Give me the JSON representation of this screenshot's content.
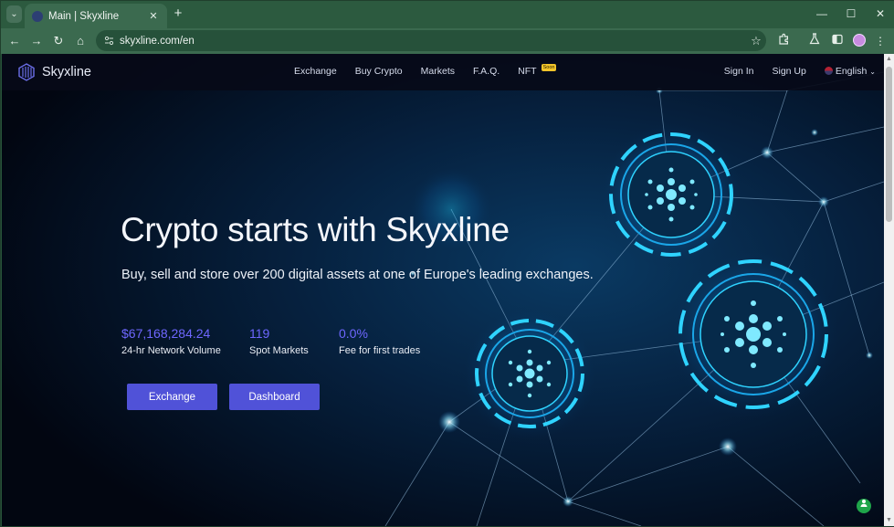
{
  "browser": {
    "tab": {
      "title": "Main | Skyxline",
      "close_glyph": "✕"
    },
    "new_tab_glyph": "+",
    "tab_search_glyph": "⌄",
    "window_controls": {
      "minimize": "—",
      "maximize": "☐",
      "close": "✕"
    },
    "nav": {
      "back": "←",
      "forward": "→",
      "reload": "↻",
      "home": "⌂"
    },
    "url": "skyxline.com/en",
    "icons": [
      "site-info-icon",
      "bookmark-star-icon",
      "extensions-icon",
      "labs-flask-icon",
      "side-panel-icon",
      "profile-avatar",
      "browser-menu-icon"
    ]
  },
  "site": {
    "brand": "Skyxline",
    "nav": {
      "exchange": "Exchange",
      "buy_crypto": "Buy Crypto",
      "markets": "Markets",
      "faq": "F.A.Q.",
      "nft": "NFT",
      "nft_badge": "Soon"
    },
    "auth": {
      "sign_in": "Sign In",
      "sign_up": "Sign Up",
      "language": "English"
    },
    "hero": {
      "title": "Crypto starts with Skyxline",
      "subtitle": "Buy, sell and store over 200 digital assets at one of Europe's leading exchanges.",
      "stats": [
        {
          "value": "$67,168,284.24",
          "label": "24-hr Network Volume"
        },
        {
          "value": "119",
          "label": "Spot Markets"
        },
        {
          "value": "0.0%",
          "label": "Fee for first trades"
        }
      ],
      "buttons": {
        "exchange": "Exchange",
        "dashboard": "Dashboard"
      }
    }
  },
  "colors": {
    "accent": "#5052d8",
    "stat_value": "#6e67ff",
    "chrome": "#3b6a4f",
    "hero_glow": "#18b4ff"
  }
}
